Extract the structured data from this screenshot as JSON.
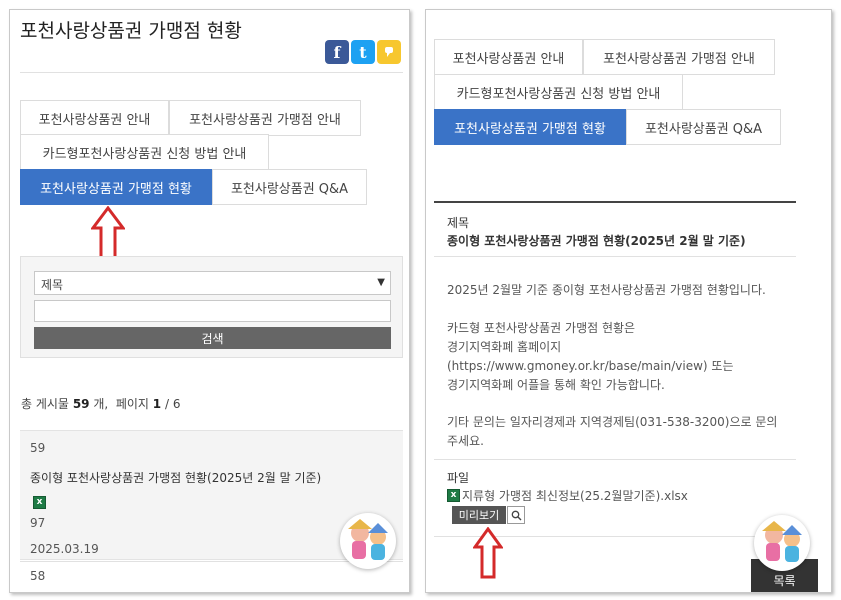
{
  "page_title": "포천사랑상품권 가맹점 현황",
  "share": {
    "facebook": "f",
    "twitter": "t",
    "kakao": ""
  },
  "tabs": [
    "포천사랑상품권 안내",
    "포천사랑상품권 가맹점 안내",
    "카드형포천사랑상품권 신청 방법 안내",
    "포천사랑상품권 가맹점 현황",
    "포천사랑상품권 Q&A"
  ],
  "active_tab": "포천사랑상품권 가맹점 현황",
  "search": {
    "field_selected": "제목",
    "query_value": "",
    "button_label": "검색"
  },
  "list_summary": {
    "prefix": "총 게시물",
    "total": "59",
    "unit": "개,",
    "page_label": "페이지",
    "page_current": "1",
    "page_sep": "/",
    "page_total": "6"
  },
  "post": {
    "number": "59",
    "title": "종이형 포천사랑상품권 가맹점 현황(2025년 2월 말 기준)",
    "attachment_icon": "excel-icon",
    "hits": "97",
    "date": "2025.03.19"
  },
  "next_post_number": "58",
  "detail": {
    "title_label": "제목",
    "title": "종이형 포천사랑상품권 가맹점 현황(2025년 2월 말 기준)",
    "body": [
      "2025년 2월말 기준 종이형 포천사랑상품권 가맹점 현황입니다.",
      "카드형 포천사랑상품권 가맹점 현황은",
      "경기지역화폐 홈페이지",
      "(https://www.gmoney.or.kr/base/main/view) 또는",
      "경기지역화폐 어플을 통해 확인 가능합니다.",
      "기타 문의는 일자리경제과 지역경제팀(031-538-3200)으로 문의",
      "주세요."
    ],
    "file_label": "파일",
    "file_name": "지류형 가맹점 최신정보(25.2월말기준).xlsx",
    "preview_label": "미리보기",
    "list_button": "목록"
  },
  "colors": {
    "active_tab": "#3a73c7",
    "arrow": "#d42a2a",
    "facebook": "#3b5998",
    "twitter": "#1da1f2",
    "kakao": "#f7c72e"
  }
}
